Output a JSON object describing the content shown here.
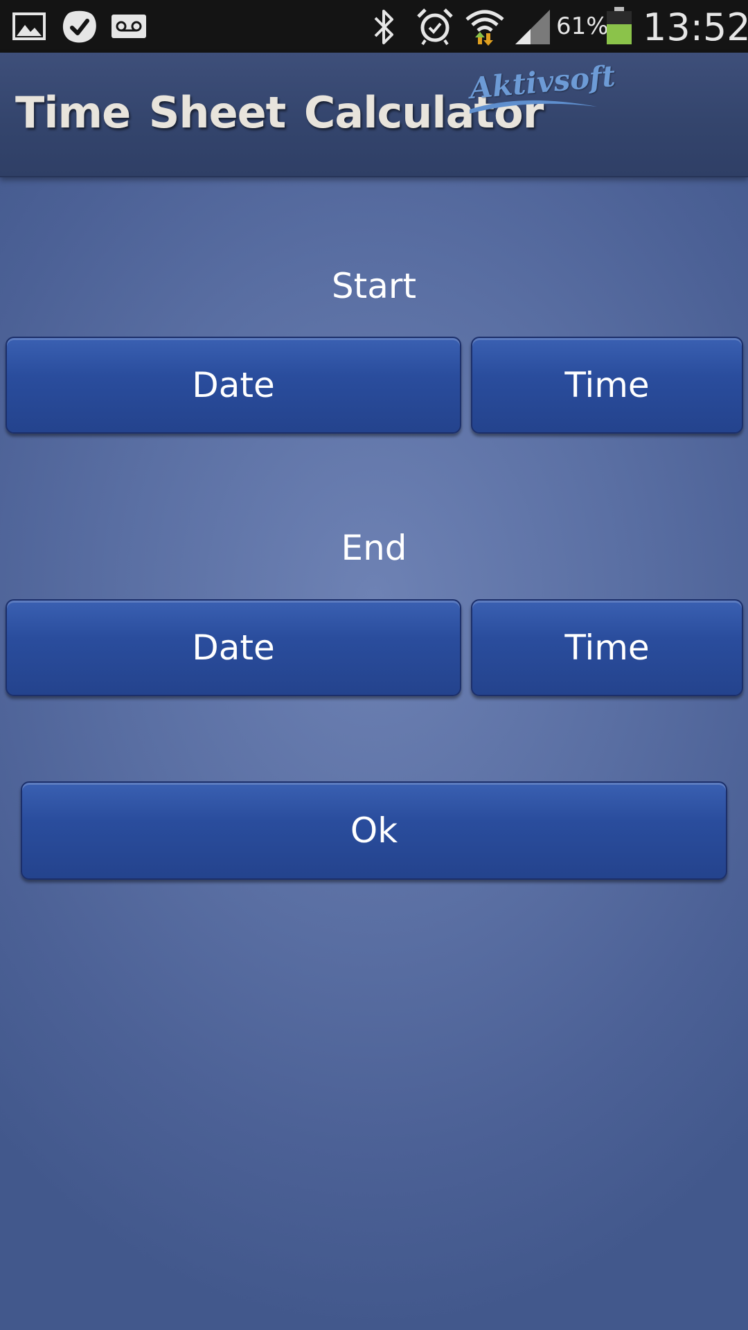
{
  "status_bar": {
    "icons_left": [
      "gallery-icon",
      "check-icon",
      "voicemail-icon"
    ],
    "icons_right": [
      "bluetooth-icon",
      "alarm-icon",
      "wifi-icon",
      "signal-icon",
      "battery-icon"
    ],
    "battery_percent": "61%",
    "battery_level": 0.61,
    "clock": "13:52"
  },
  "app_bar": {
    "title": "Time Sheet  Calculator",
    "brand": "Aktivsoft"
  },
  "start": {
    "label": "Start",
    "date_button": "Date",
    "time_button": "Time"
  },
  "end": {
    "label": "End",
    "date_button": "Date",
    "time_button": "Time"
  },
  "ok_button": "Ok",
  "colors": {
    "background": "#5a6fa3",
    "button": "#2a4d9d",
    "battery": "#8bc34a"
  }
}
